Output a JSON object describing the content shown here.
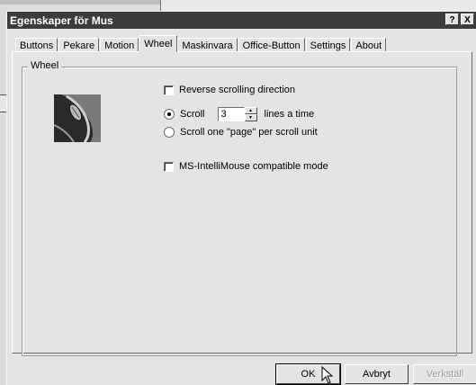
{
  "dialog": {
    "title": "Egenskaper för Mus",
    "help_label": "?",
    "close_label": "X"
  },
  "tabs": [
    {
      "label": "Buttons"
    },
    {
      "label": "Pekare"
    },
    {
      "label": "Motion"
    },
    {
      "label": "Wheel",
      "active": true
    },
    {
      "label": "Maskinvara"
    },
    {
      "label": "Office-Button"
    },
    {
      "label": "Settings"
    },
    {
      "label": "About"
    }
  ],
  "wheel_group": {
    "legend": "Wheel",
    "reverse_label": "Reverse scrolling direction",
    "reverse_checked": false,
    "scroll_label": "Scroll",
    "scroll_value": "3",
    "scroll_suffix": "lines a time",
    "scroll_selected": true,
    "page_label": "Scroll one \"page\" per scroll unit",
    "page_selected": false,
    "intellimouse_label": "MS-IntelliMouse compatible mode",
    "intellimouse_checked": false
  },
  "buttons": {
    "ok": "OK",
    "cancel": "Avbryt",
    "apply": "Verkställ"
  }
}
